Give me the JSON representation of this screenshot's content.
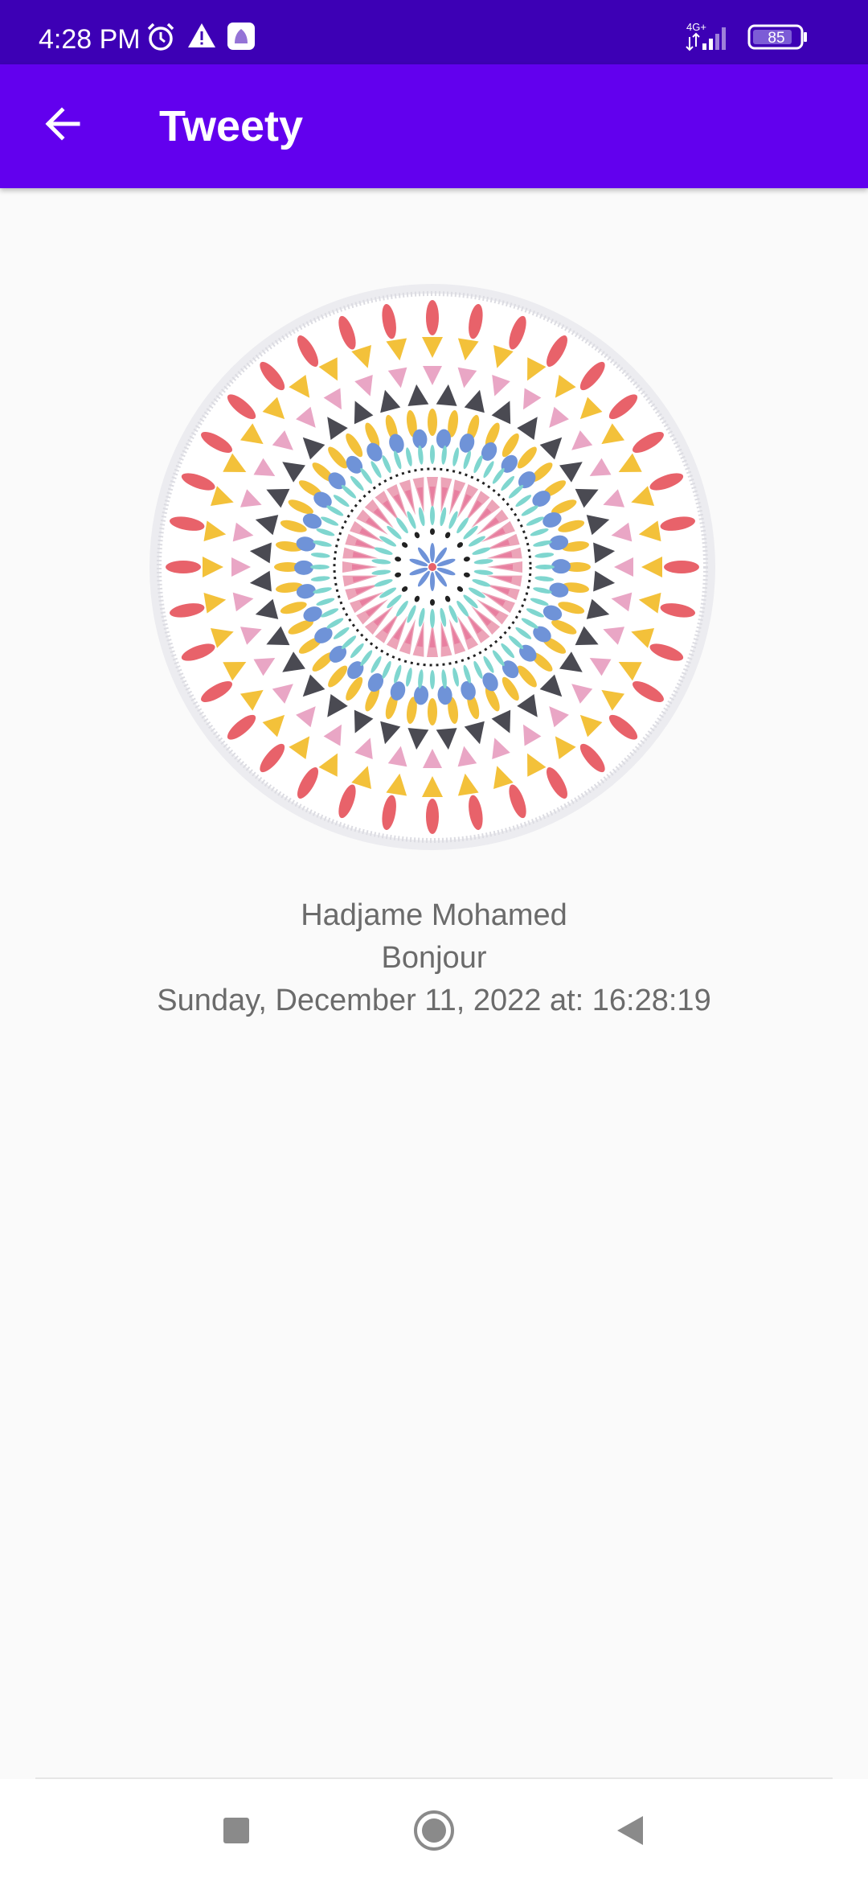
{
  "status_bar": {
    "time": "4:28 PM",
    "network": "4G+",
    "battery": "85",
    "icons": [
      "alarm-icon",
      "warning-icon",
      "notification-app-icon",
      "signal-icon",
      "battery-icon"
    ]
  },
  "app_bar": {
    "title": "Tweety",
    "back_icon": "arrow-back-icon"
  },
  "post": {
    "image": "mandala-image",
    "author": "Hadjame Mohamed",
    "message": "Bonjour",
    "date": "Sunday, December 11, 2022 at: 16:28:19"
  },
  "nav_bar": {
    "icons": [
      "recents-square-icon",
      "home-circle-icon",
      "back-triangle-icon"
    ]
  },
  "colors": {
    "status_bar": "#3d00b5",
    "app_bar": "#6200ee",
    "background": "#fafafa",
    "text": "#6b6b6b"
  }
}
